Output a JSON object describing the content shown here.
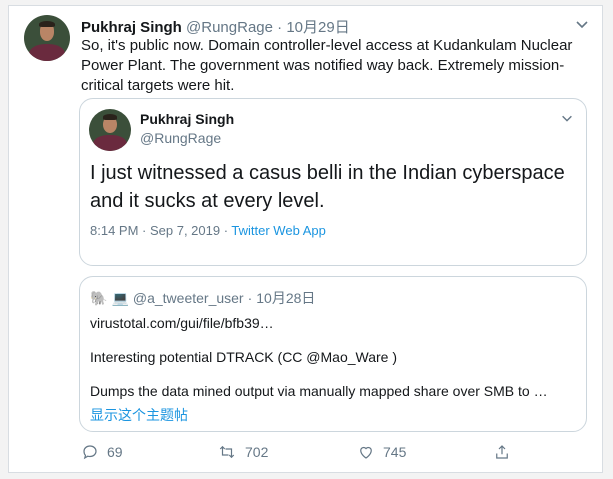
{
  "tweet": {
    "author_name": "Pukhraj Singh",
    "author_handle": "@RungRage",
    "date": "10月29日",
    "separator": "·",
    "text": "So, it's public now. Domain controller-level access at Kudankulam Nuclear Power Plant. The government was notified way back. Extremely mission-critical targets were hit."
  },
  "quoted_tweet": {
    "author_name": "Pukhraj Singh",
    "author_handle": "@RungRage",
    "text": "I just witnessed a casus belli in the Indian cyberspace and it sucks at every level.",
    "timestamp": "8:14 PM · Sep 7, 2019 · ",
    "source": "Twitter Web App"
  },
  "second_quote": {
    "avatar_emoji": "🐘",
    "name_emoji": "💻",
    "handle": "@a_tweeter_user",
    "separator": "·",
    "date": "10月28日",
    "line1": "virustotal.com/gui/file/bfb39…",
    "line2": "Interesting potential DTRACK (CC @Mao_Ware )",
    "line3": "Dumps the data mined output via manually mapped share over SMB to …",
    "show_thread": "显示这个主题帖"
  },
  "actions": {
    "replies": "69",
    "retweets": "702",
    "likes": "745"
  },
  "icons": [
    "chevron-down-icon",
    "reply-icon",
    "retweet-icon",
    "like-icon",
    "share-icon"
  ],
  "colors": {
    "link": "#1b95e0",
    "muted": "#657786",
    "text": "#14171a",
    "border": "#ccd6dd"
  }
}
